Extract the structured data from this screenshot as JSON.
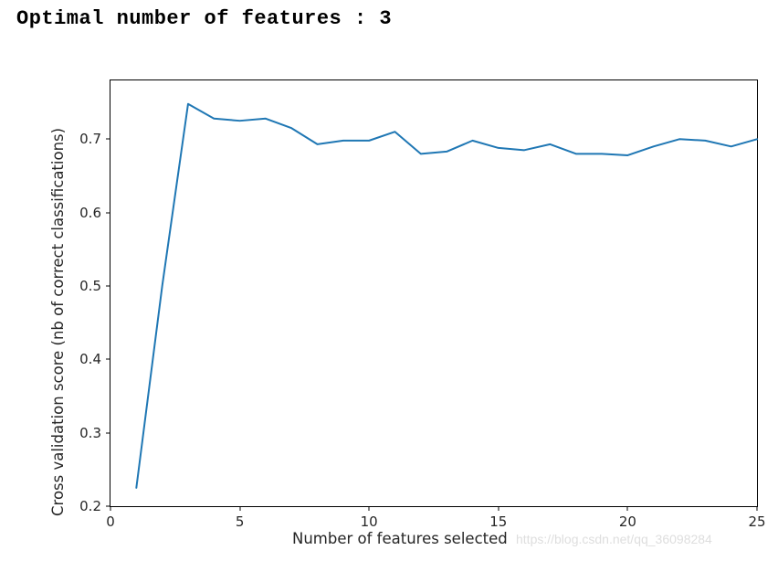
{
  "header": {
    "text": "Optimal number of features : 3"
  },
  "chart_data": {
    "type": "line",
    "xlabel": "Number of features selected",
    "ylabel": "Cross validation score (nb of correct classifications)",
    "xlim": [
      0,
      25
    ],
    "ylim": [
      0.2,
      0.78
    ],
    "xticks": [
      0,
      5,
      10,
      15,
      20,
      25
    ],
    "yticks": [
      0.2,
      0.3,
      0.4,
      0.5,
      0.6,
      0.7
    ],
    "x": [
      1,
      2,
      3,
      4,
      5,
      6,
      7,
      8,
      9,
      10,
      11,
      12,
      13,
      14,
      15,
      16,
      17,
      18,
      19,
      20,
      21,
      22,
      23,
      24,
      25
    ],
    "y": [
      0.225,
      0.5,
      0.748,
      0.728,
      0.725,
      0.728,
      0.715,
      0.693,
      0.698,
      0.698,
      0.71,
      0.68,
      0.683,
      0.698,
      0.688,
      0.685,
      0.693,
      0.68,
      0.68,
      0.678,
      0.69,
      0.7,
      0.698,
      0.69,
      0.7
    ],
    "line_color": "#1f77b4",
    "watermark": "https://blog.csdn.net/qq_36098284"
  }
}
